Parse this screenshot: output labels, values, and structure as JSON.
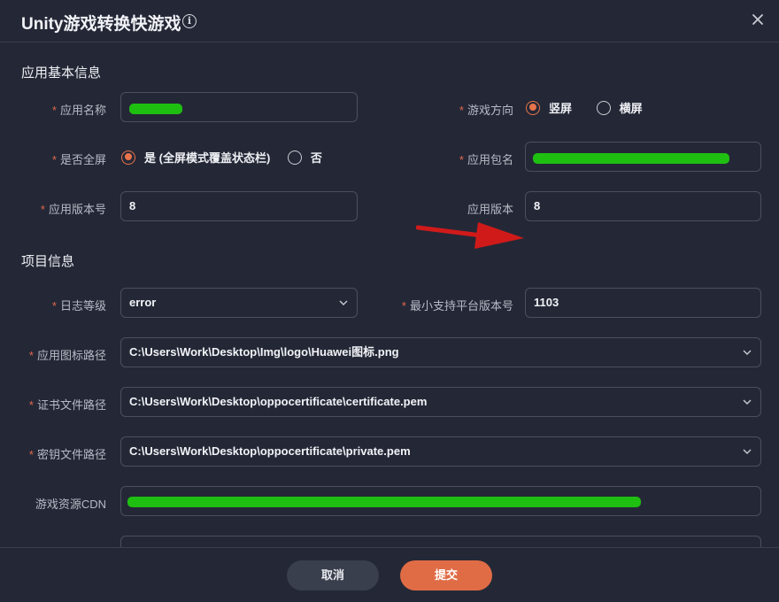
{
  "dialog": {
    "title": "Unity游戏转换快游戏",
    "info_icon": "info-icon",
    "close_icon": "close-icon"
  },
  "sections": {
    "basic": "应用基本信息",
    "project": "项目信息"
  },
  "required_mark": "*",
  "fields": {
    "app_name": {
      "label": "应用名称",
      "value": ""
    },
    "orientation": {
      "label": "游戏方向",
      "options": [
        "竖屏",
        "横屏"
      ],
      "selected": "竖屏"
    },
    "fullscreen": {
      "label": "是否全屏",
      "options": [
        "是 (全屏模式覆盖状态栏)",
        "否"
      ],
      "selected": "是 (全屏模式覆盖状态栏)"
    },
    "package_name": {
      "label": "应用包名",
      "value": ""
    },
    "version_code": {
      "label": "应用版本号",
      "value": "8"
    },
    "version_name": {
      "label": "应用版本",
      "value": "8"
    },
    "log_level": {
      "label": "日志等级",
      "value": "error"
    },
    "min_platform": {
      "label": "最小支持平台版本号",
      "value": "1103"
    },
    "icon_path": {
      "label": "应用图标路径",
      "value": "C:\\Users\\Work\\Desktop\\Img\\logo\\Huawei图标.png"
    },
    "cert_path": {
      "label": "证书文件路径",
      "value": "C:\\Users\\Work\\Desktop\\oppocertificate\\certificate.pem"
    },
    "key_path": {
      "label": "密钥文件路径",
      "value": "C:\\Users\\Work\\Desktop\\oppocertificate\\private.pem"
    },
    "cdn": {
      "label": "游戏资源CDN",
      "value": ""
    }
  },
  "buttons": {
    "cancel": "取消",
    "submit": "提交"
  },
  "colors": {
    "accent": "#e06c46",
    "background": "#242836",
    "redaction": "#1fbf12",
    "annotation_arrow": "#d01a1a"
  }
}
